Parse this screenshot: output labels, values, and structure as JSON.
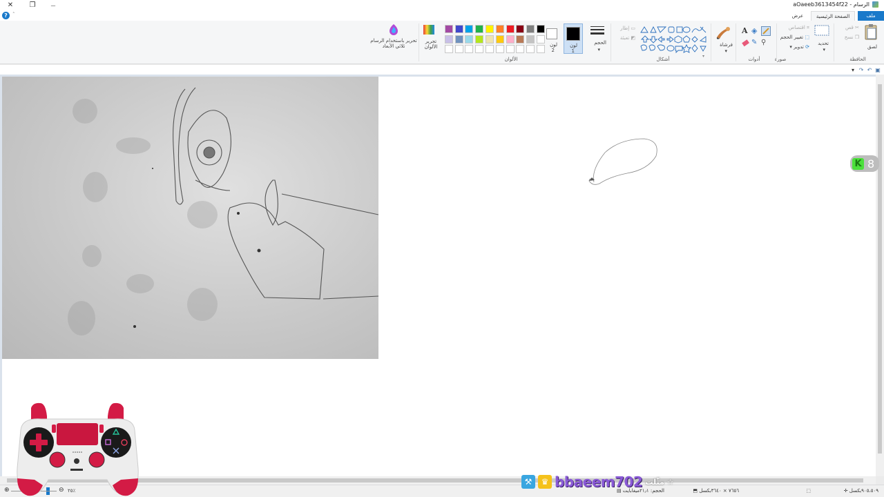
{
  "window": {
    "title": "aOaeeb3613454f22 - الرسام",
    "close_glyph": "✕",
    "restore_glyph": "❐",
    "minimize_glyph": "—"
  },
  "tabs": {
    "file": "ملف",
    "home": "الصفحة الرئيسية",
    "view": "عرض"
  },
  "help_glyph": "?",
  "collapse_glyph": "˄",
  "ribbon": {
    "clipboard": {
      "label": "الحافظة",
      "paste": "لصق",
      "cut": "قص",
      "copy": "نسخ"
    },
    "image": {
      "label": "صورة",
      "select": "تحديد",
      "crop": "اقتصاص",
      "resize": "تغيير الحجم",
      "rotate": "تدوير"
    },
    "tools": {
      "label": "أدوات"
    },
    "brushes": {
      "label": "فرشاة"
    },
    "shapes": {
      "label": "أشكال",
      "outline": "إطار",
      "fill": "تعبئة"
    },
    "size": {
      "label": "الحجم"
    },
    "color1": {
      "label": "لون",
      "num": "1"
    },
    "color2": {
      "label": "لون",
      "num": "2"
    },
    "colors": {
      "label": "الألوان",
      "edit": "تحرير الألوان",
      "edit3d": "تحرير باستخدام الرسام ثلاثي الأبعاد",
      "row1": [
        "#000000",
        "#7f7f7f",
        "#880015",
        "#ed1c24",
        "#ff7f27",
        "#fff200",
        "#22b14c",
        "#00a2e8",
        "#3f48cc",
        "#a349a4"
      ],
      "row2": [
        "#ffffff",
        "#c3c3c3",
        "#b97a57",
        "#ffaec9",
        "#ffc90e",
        "#efe4b0",
        "#b5e61d",
        "#99d9ea",
        "#7092be",
        "#c8bfe7"
      ]
    }
  },
  "status": {
    "position": "٩٠٥،٥٠٩بكسل",
    "selection": "",
    "dimensions": "٧٦٥٦ × ٣٦٤٠بكسل",
    "filesize": "الحجم: ٢١٫١ميغابايت",
    "zoom": "٢٥٪"
  },
  "overlay": {
    "counter_value": "8",
    "counter_icon": "K",
    "brand_name": "bbaeem702",
    "brand_tail": "مثّلت ☆"
  },
  "colors": {
    "accent": "#1979ca",
    "canvas_bg": "#dae2ec",
    "ribbon_bg": "#f5f6f7"
  }
}
